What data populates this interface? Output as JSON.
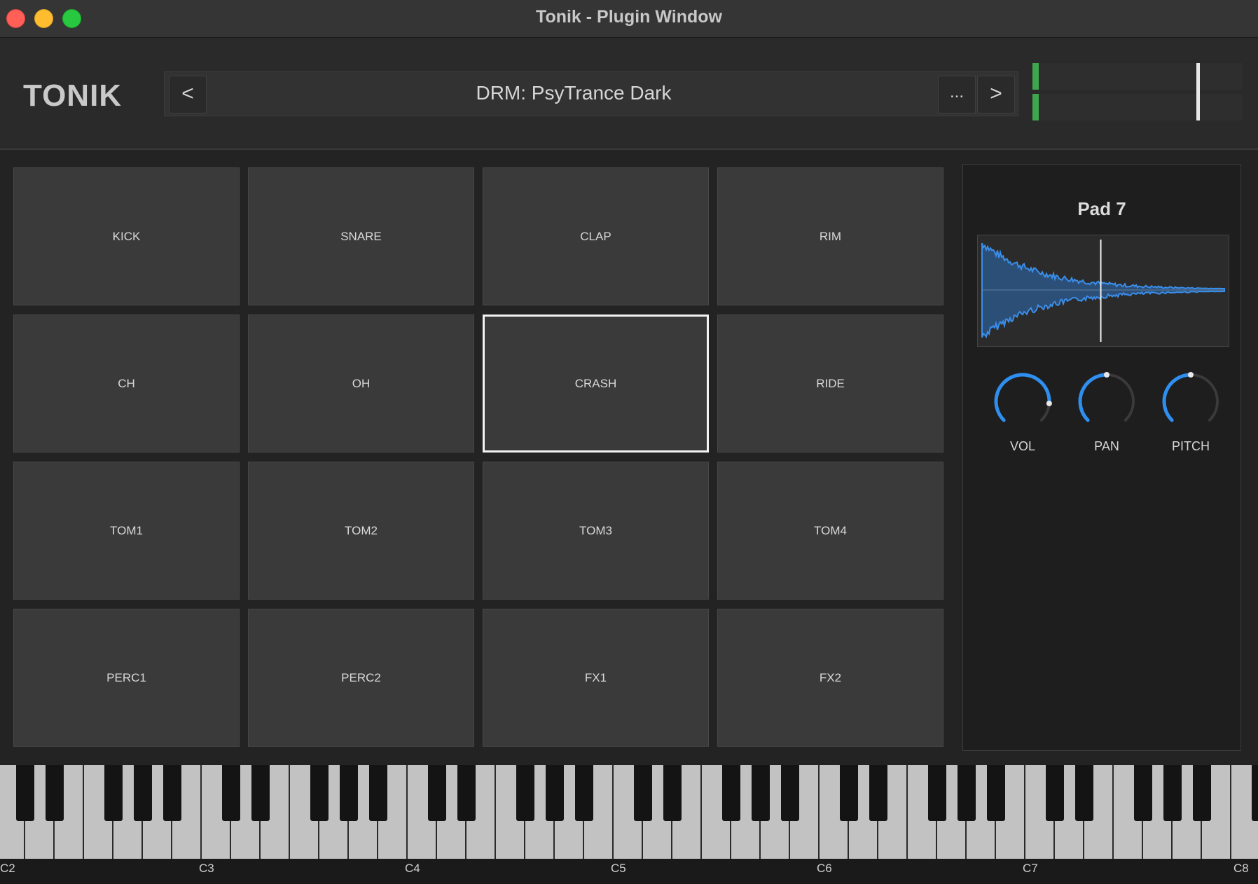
{
  "window": {
    "title": "Tonik - Plugin Window"
  },
  "header": {
    "logo": "TONIK",
    "preset": {
      "name": "DRM: PsyTrance Dark",
      "prev_label": "<",
      "next_label": ">",
      "menu_label": "..."
    },
    "meter": {
      "left_level": 0.03,
      "right_level": 0.03,
      "peak_level": 0.78,
      "color": "#3fa64f"
    }
  },
  "pads": [
    {
      "label": "KICK"
    },
    {
      "label": "SNARE"
    },
    {
      "label": "CLAP"
    },
    {
      "label": "RIM"
    },
    {
      "label": "CH"
    },
    {
      "label": "OH"
    },
    {
      "label": "CRASH",
      "selected": true
    },
    {
      "label": "RIDE"
    },
    {
      "label": "TOM1"
    },
    {
      "label": "TOM2"
    },
    {
      "label": "TOM3"
    },
    {
      "label": "TOM4"
    },
    {
      "label": "PERC1"
    },
    {
      "label": "PERC2"
    },
    {
      "label": "FX1"
    },
    {
      "label": "FX2"
    }
  ],
  "side_panel": {
    "title": "Pad 7",
    "waveform": {
      "color": "#3a8eea",
      "playhead_fraction": 0.49
    },
    "knobs": [
      {
        "label": "VOL",
        "value": 0.85
      },
      {
        "label": "PAN",
        "value": 0.5
      },
      {
        "label": "PITCH",
        "value": 0.5
      }
    ],
    "accent": "#2f8ff0"
  },
  "keyboard": {
    "octave_labels": [
      "C2",
      "C3",
      "C4",
      "C5",
      "C6",
      "C7",
      "C8"
    ]
  }
}
